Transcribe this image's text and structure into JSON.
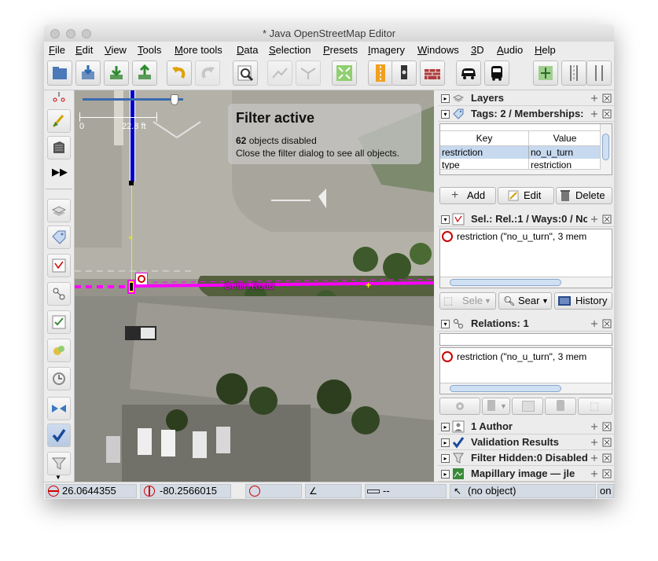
{
  "window": {
    "title": "* Java OpenStreetMap Editor"
  },
  "menu": [
    "File",
    "Edit",
    "View",
    "Tools",
    "More tools",
    "Data",
    "Selection",
    "Presets",
    "Imagery",
    "Windows",
    "3D",
    "Audio",
    "Help"
  ],
  "map": {
    "filter_title": "Filter active",
    "filter_count": "62",
    "filter_count_suffix": "objects disabled",
    "filter_hint": "Close the filter dialog to see all objects.",
    "scale_zero": "0",
    "scale_length": "22.8 ft",
    "road_label": "Griffin Road"
  },
  "panels": {
    "layers": {
      "title": "Layers"
    },
    "tags": {
      "title": "Tags: 2 / Memberships:",
      "col_key": "Key",
      "col_value": "Value",
      "rows": [
        {
          "key": "restriction",
          "value": "no_u_turn"
        },
        {
          "key": "type",
          "value": "restriction"
        }
      ],
      "add_label": "Add",
      "edit_label": "Edit",
      "delete_label": "Delete"
    },
    "selection": {
      "title": "Sel.: Rel.:1 / Ways:0 / No",
      "item": "restriction (\"no_u_turn\", 3 mem",
      "select_label": "Sele",
      "search_label": "Sear",
      "history_label": "History"
    },
    "relations": {
      "title": "Relations: 1",
      "item": "restriction (\"no_u_turn\", 3 mem"
    },
    "author": {
      "title": "1 Author"
    },
    "validation": {
      "title": "Validation Results"
    },
    "filter": {
      "title": "Filter Hidden:0 Disabled"
    },
    "mapillary": {
      "title": "Mapillary image — jle"
    }
  },
  "status": {
    "lat": "26.0644355",
    "lon": "-80.2566015",
    "heading": "",
    "angle": "",
    "distance": "--",
    "object": "(no object)",
    "right_text": "on"
  },
  "colors": {
    "selection": "#ff00ff",
    "way_blue": "#0000c8",
    "node_yellow": "#f0f000",
    "status_bg": "#d5dbe4",
    "selected_row": "#c7d9ef"
  }
}
